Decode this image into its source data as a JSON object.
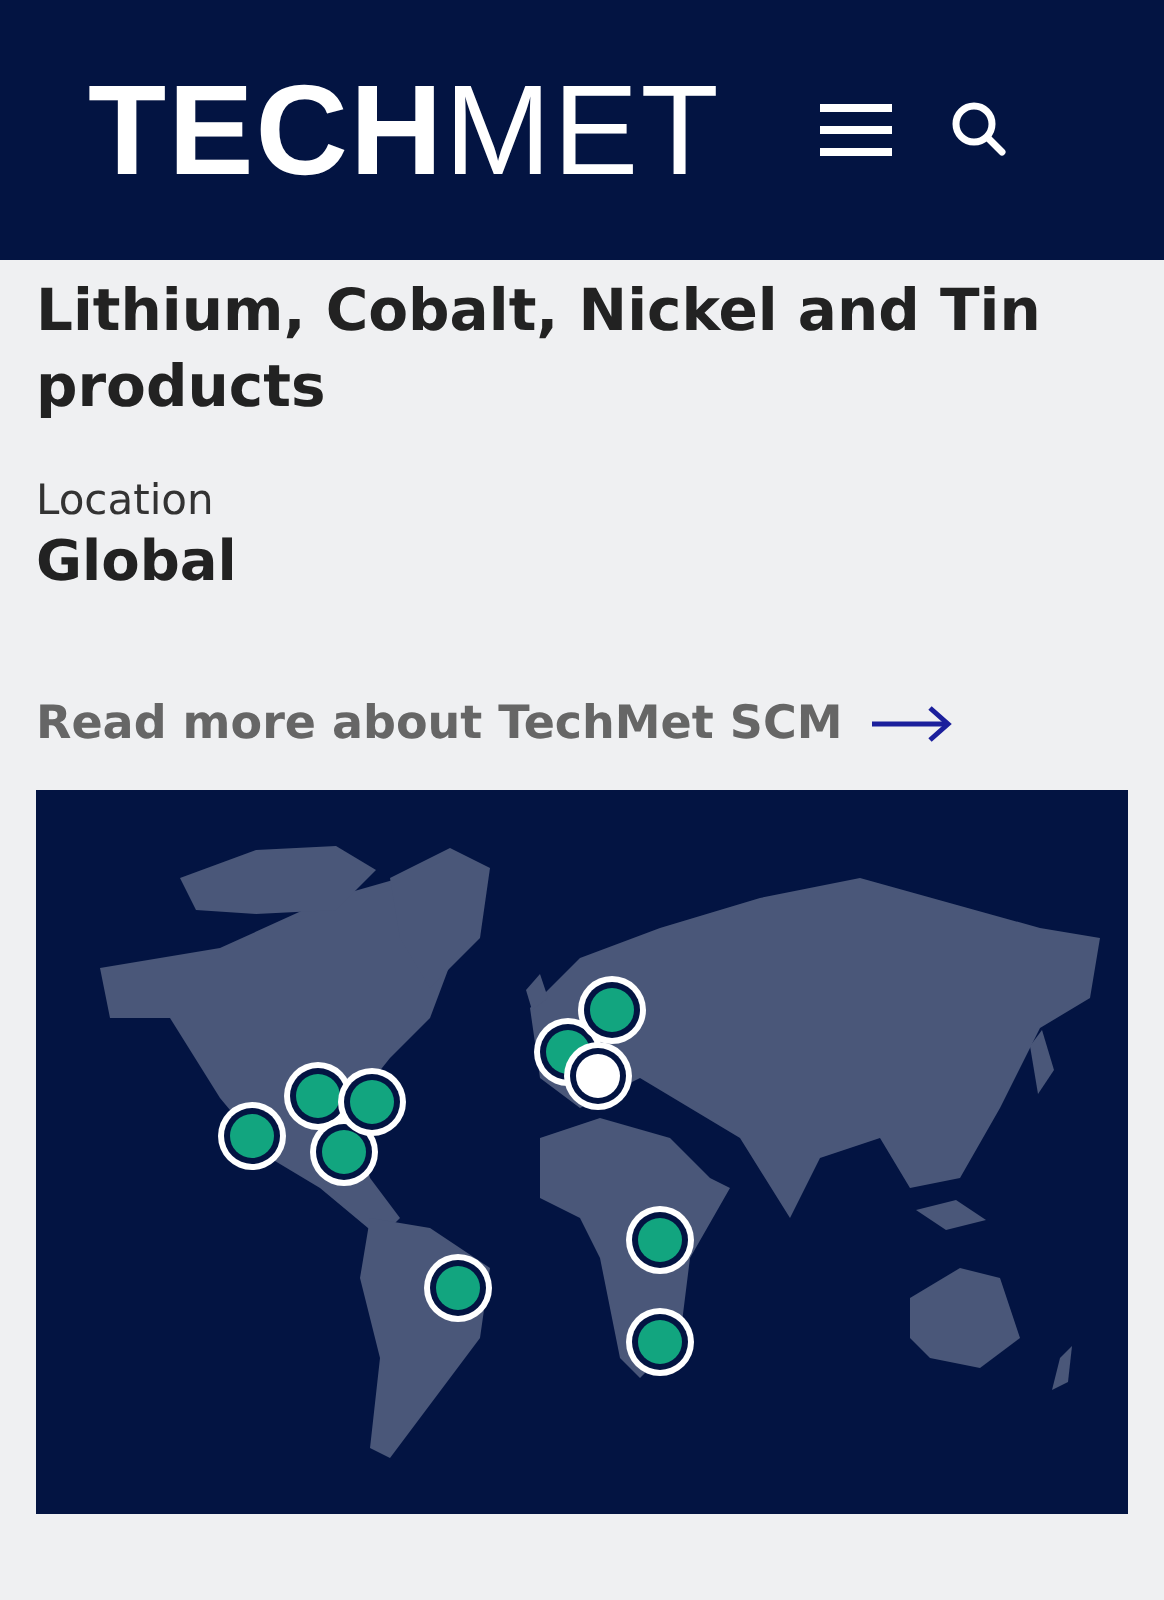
{
  "header": {
    "logo": "**TECH**MET"
  },
  "title": "Lithium, Cobalt, Nickel and Tin products",
  "location": {
    "label": "Location",
    "value": "Global"
  },
  "link": {
    "label": "Read more about TechMet SCM"
  },
  "map": {
    "pins": [
      {
        "selected": false
      },
      {
        "selected": false
      },
      {
        "selected": false
      },
      {
        "selected": false
      },
      {
        "selected": false
      },
      {
        "selected": false
      },
      {
        "selected": false
      },
      {
        "selected": true
      },
      {
        "selected": false
      },
      {
        "selected": false
      }
    ]
  }
}
